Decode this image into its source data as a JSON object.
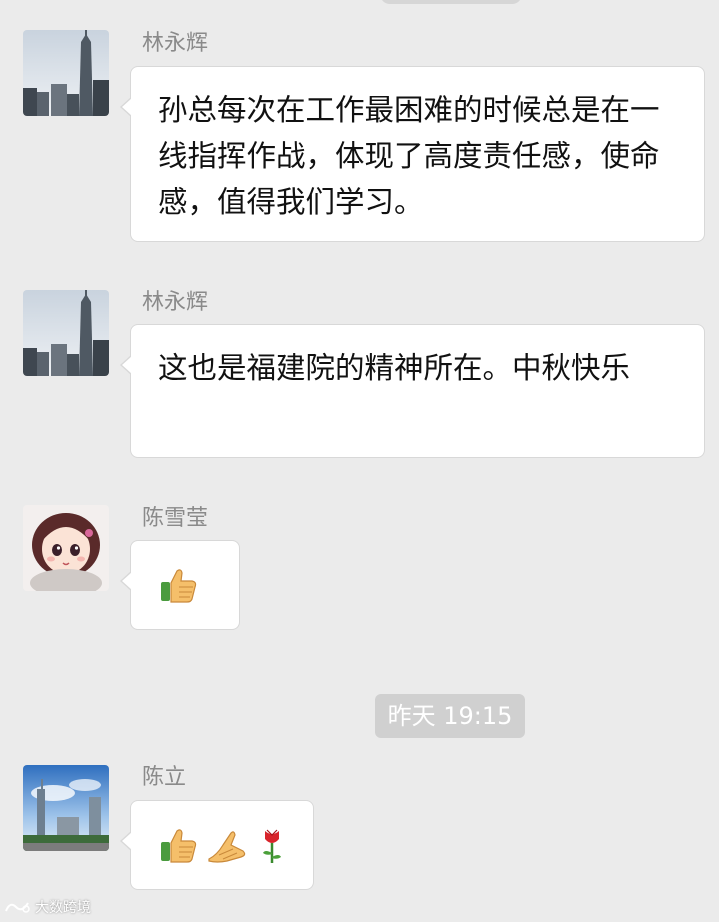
{
  "messages": [
    {
      "sender": "林永辉",
      "avatar_icon": "skyscraper-photo-avatar",
      "text": "孙总每次在工作最困难的时候总是在一线指挥作战，体现了高度责任感，使命感，值得我们学习。"
    },
    {
      "sender": "林永辉",
      "avatar_icon": "skyscraper-photo-avatar",
      "text": "这也是福建院的精神所在。中秋快乐"
    },
    {
      "sender": "陈雪莹",
      "avatar_icon": "cartoon-girl-avatar",
      "emojis": [
        "thumbs-up-icon"
      ]
    },
    {
      "sender": "陈立",
      "avatar_icon": "city-skyline-avatar",
      "emojis": [
        "thumbs-up-icon",
        "handshake-icon",
        "rose-icon"
      ]
    }
  ],
  "timestamp": "昨天 19:15",
  "watermark": "大数跨境",
  "colors": {
    "background": "#ebebeb",
    "bubble": "#ffffff",
    "sender_name": "#8a8a8a",
    "timestamp_bg": "#d0d0d0"
  }
}
